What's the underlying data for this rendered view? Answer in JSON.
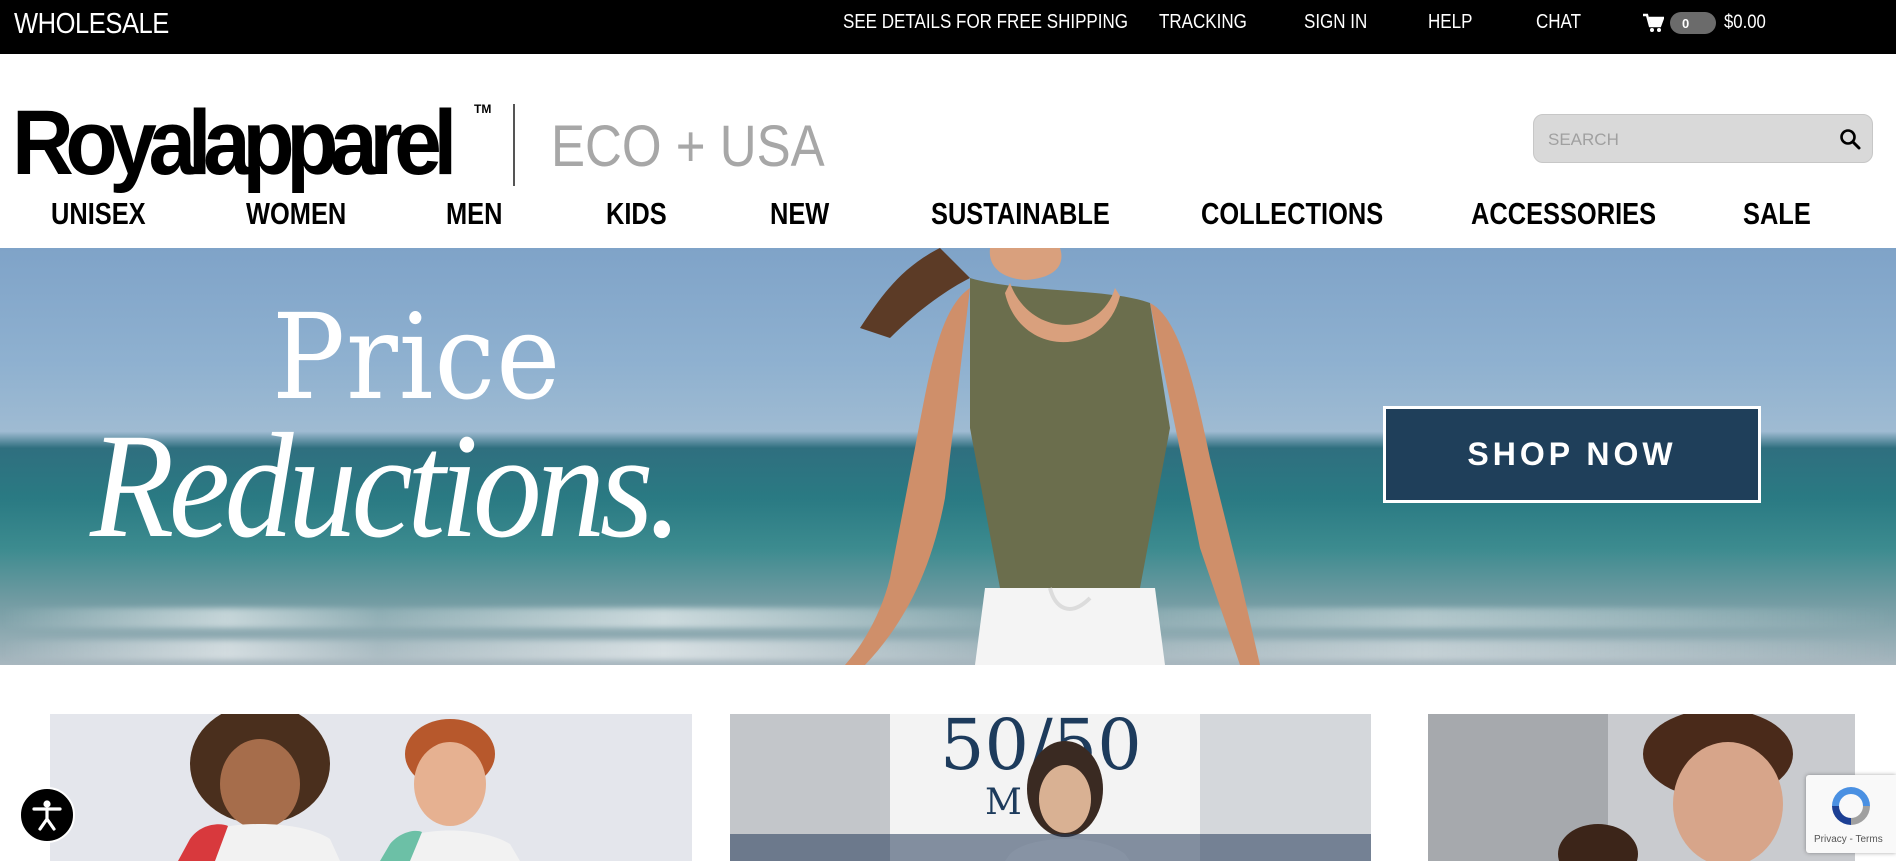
{
  "topbar": {
    "wholesale": "WHOLESALE",
    "links": [
      "SEE DETAILS FOR FREE SHIPPING",
      "TRACKING",
      "SIGN IN",
      "HELP",
      "CHAT"
    ],
    "cart_count": "0",
    "cart_total": "$0.00"
  },
  "header": {
    "logo_text": "Royalapparel",
    "logo_tm": "TM",
    "tagline": "ECO + USA",
    "search_placeholder": "SEARCH"
  },
  "nav": {
    "items": [
      "UNISEX",
      "WOMEN",
      "MEN",
      "KIDS",
      "NEW",
      "SUSTAINABLE",
      "COLLECTIONS",
      "ACCESSORIES",
      "SALE"
    ]
  },
  "hero": {
    "line1": "Price",
    "line2": "Reductions.",
    "cta": "SHOP NOW"
  },
  "recaptcha": {
    "text": "Privacy - Terms"
  },
  "colors": {
    "topbar_bg": "#000000",
    "search_bg": "#d9d9d9",
    "tagline": "#a7a7a7"
  }
}
